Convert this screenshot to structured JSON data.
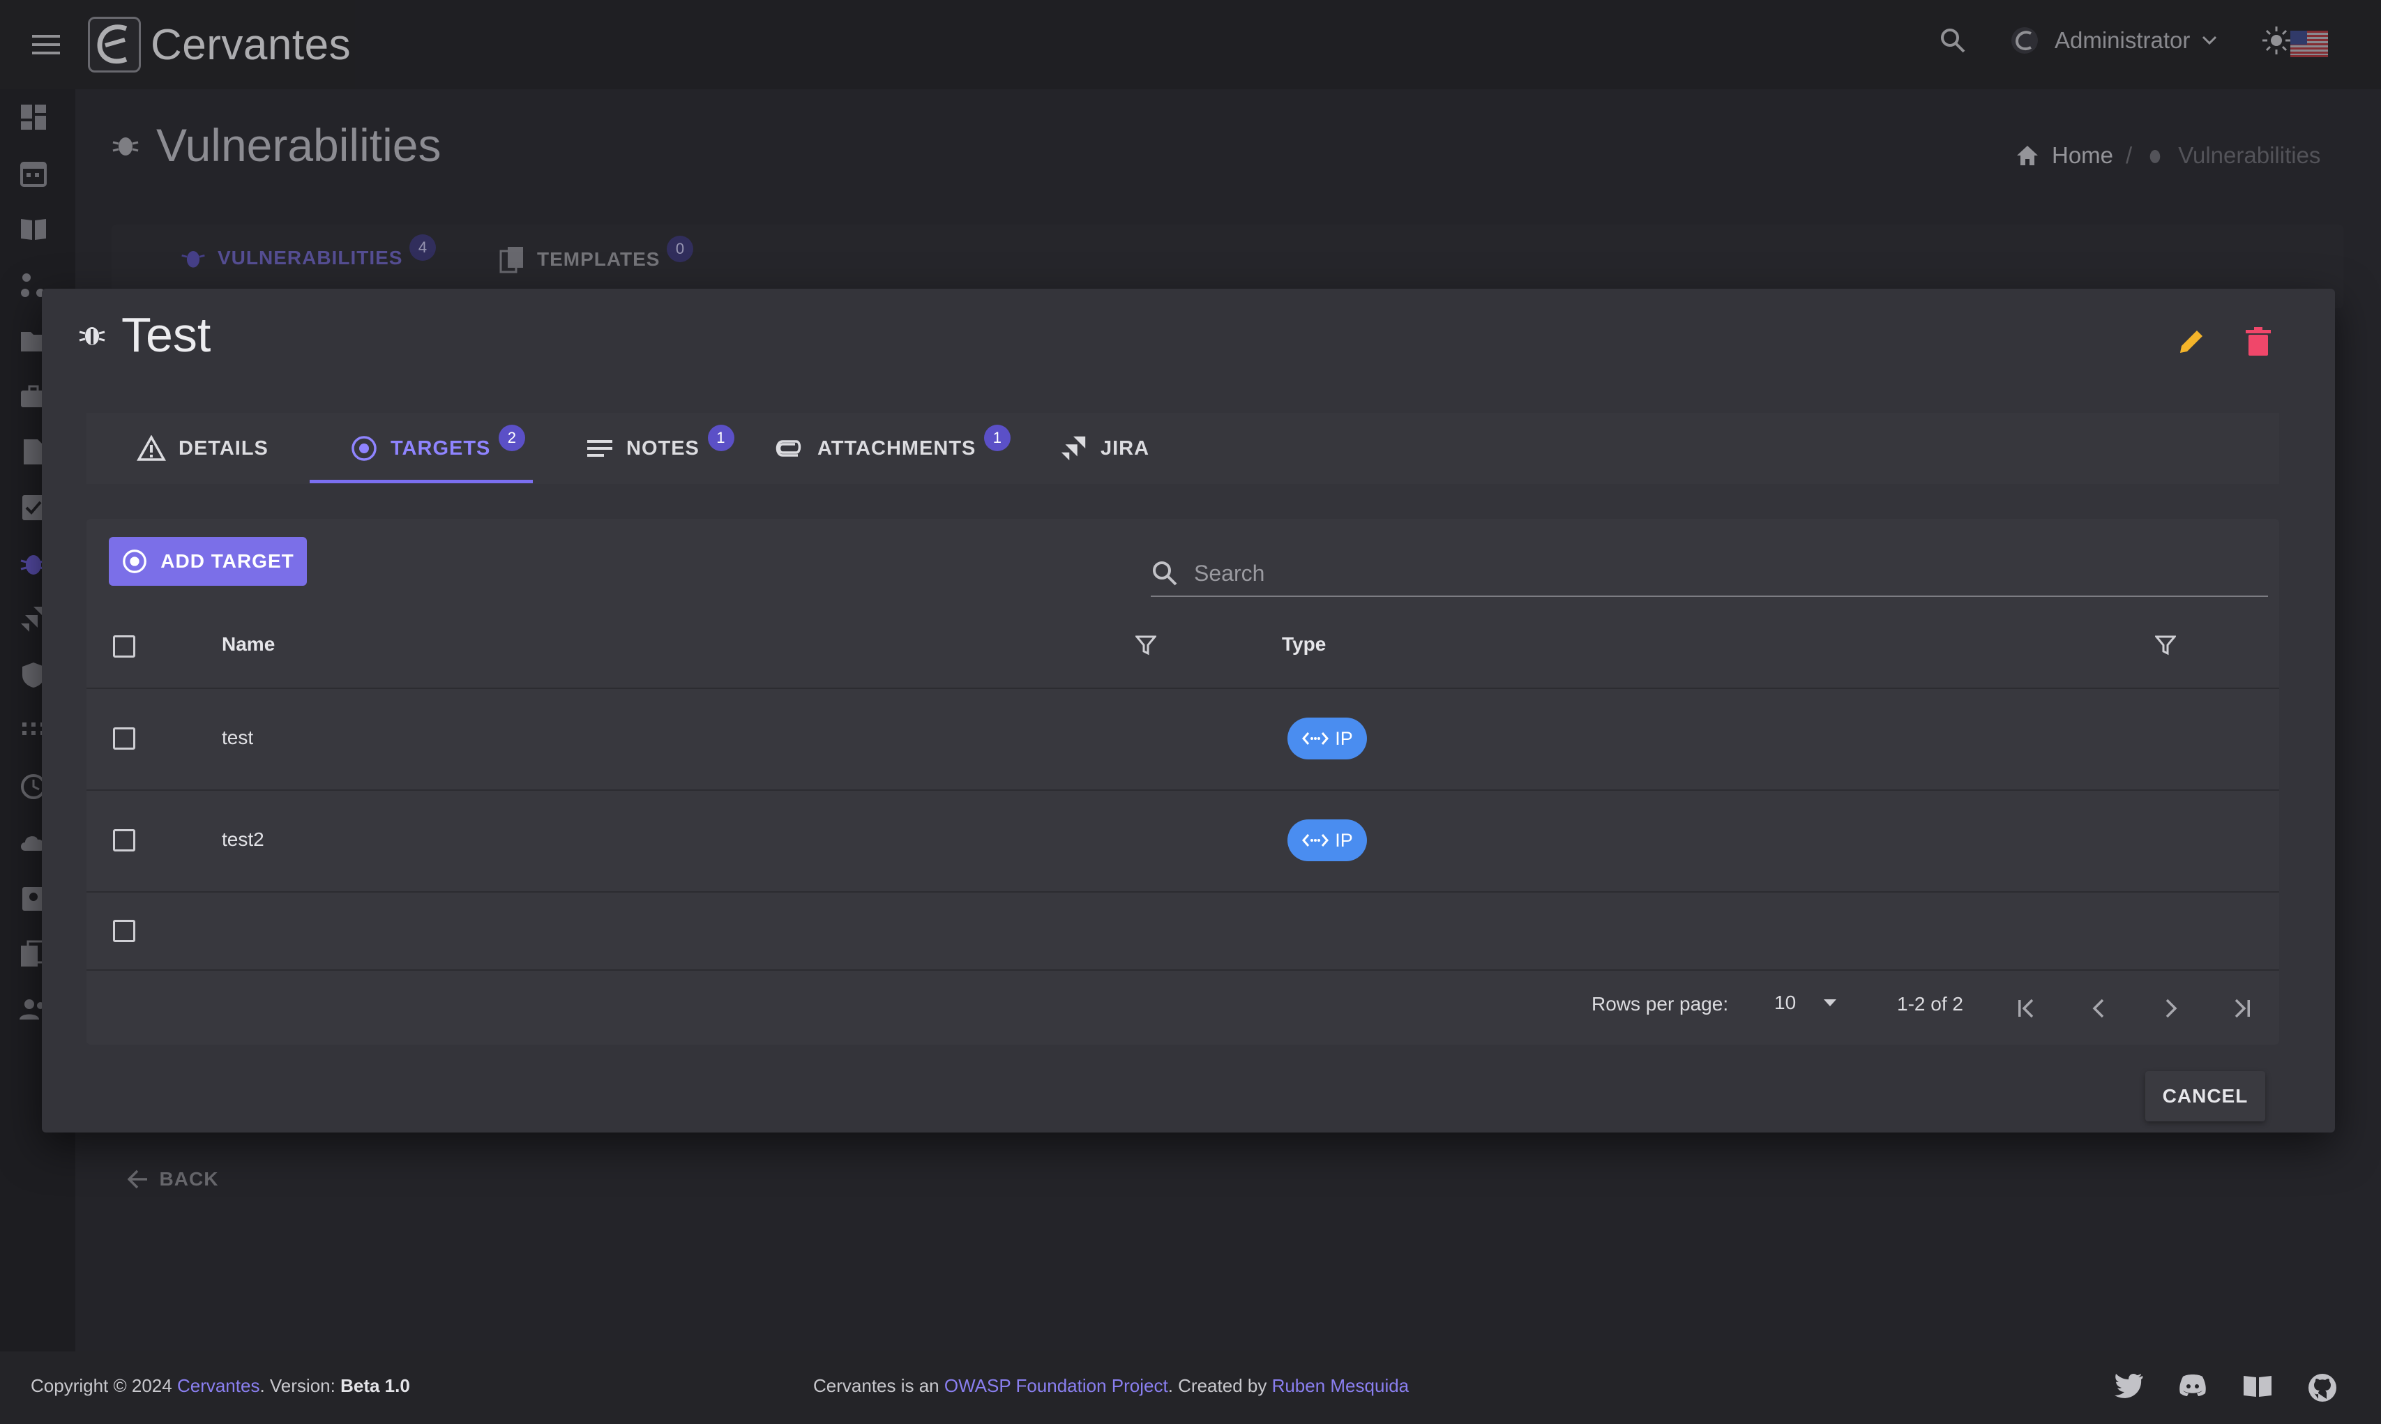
{
  "app": {
    "name": "Cervantes",
    "user": "Administrator"
  },
  "page": {
    "title": "Vulnerabilities"
  },
  "breadcrumb": {
    "home": "Home",
    "current": "Vulnerabilities"
  },
  "background_tabs": [
    {
      "label": "VULNERABILITIES",
      "badge": "4"
    },
    {
      "label": "TEMPLATES",
      "badge": "0"
    }
  ],
  "back_label": "BACK",
  "dialog": {
    "title": "Test",
    "tabs": [
      {
        "label": "DETAILS",
        "badge": ""
      },
      {
        "label": "TARGETS",
        "badge": "2"
      },
      {
        "label": "NOTES",
        "badge": "1"
      },
      {
        "label": "ATTACHMENTS",
        "badge": "1"
      },
      {
        "label": "JIRA",
        "badge": ""
      }
    ],
    "active_tab": "TARGETS",
    "add_target_label": "ADD TARGET",
    "search_placeholder": "Search",
    "table": {
      "columns": [
        "Name",
        "Type"
      ],
      "rows": [
        {
          "name": "test",
          "type": "IP"
        },
        {
          "name": "test2",
          "type": "IP"
        }
      ]
    },
    "pagination": {
      "rows_per_page_label": "Rows per page:",
      "rows_per_page": "10",
      "range": "1-2 of 2"
    },
    "cancel_label": "CANCEL"
  },
  "footer": {
    "copyright": "Copyright © 2024 ",
    "brand_link": "Cervantes",
    "version_prefix": ". Version: ",
    "version": "Beta 1.0",
    "owasp_prefix": "Cervantes is an ",
    "owasp_link": "OWASP Foundation Project",
    "created_prefix": ". Created by ",
    "author_link": "Ruben Mesquida"
  },
  "colors": {
    "accent": "#7b6ff0",
    "chip": "#4a8df0",
    "edit": "#f4b42a",
    "delete": "#f0476a"
  }
}
